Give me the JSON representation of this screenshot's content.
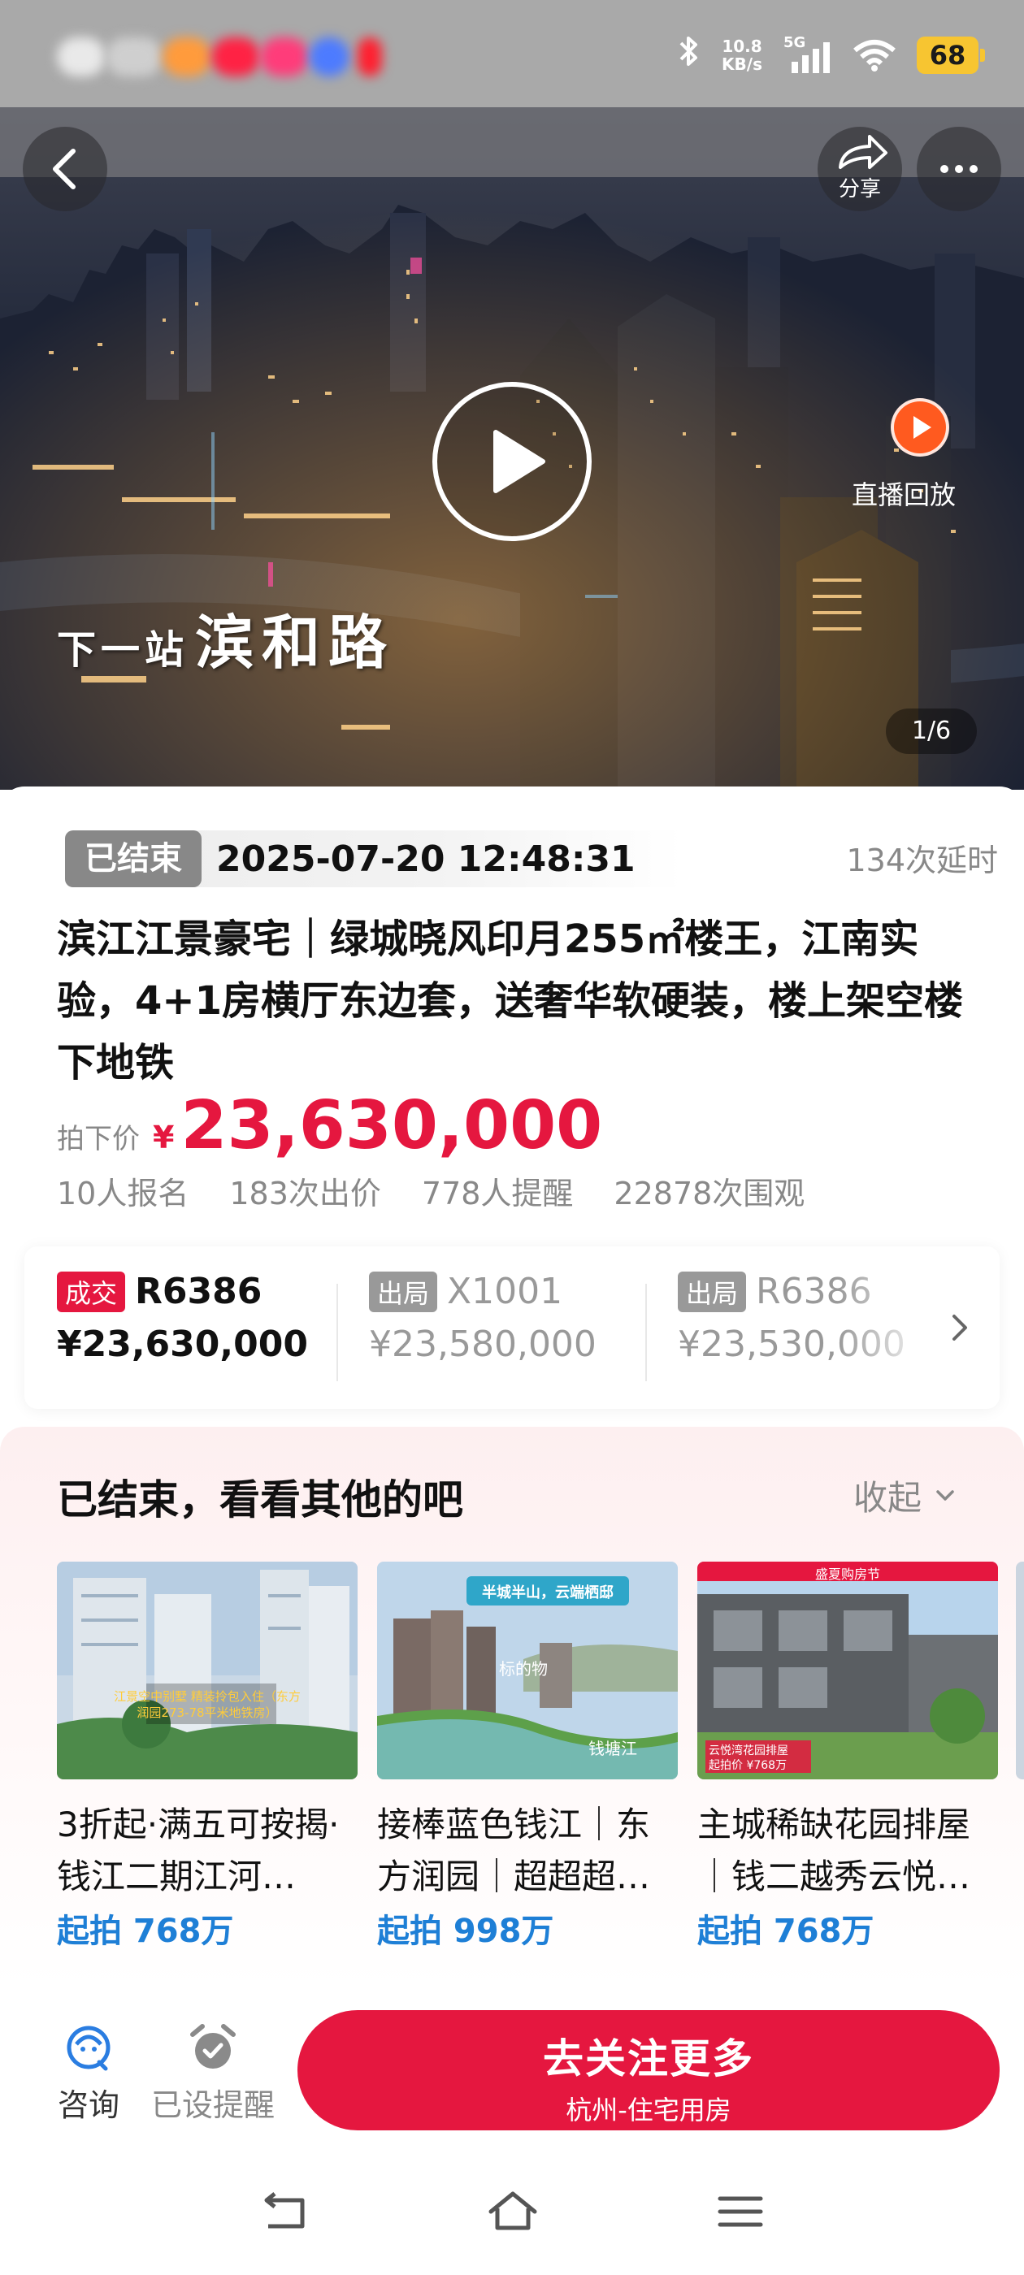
{
  "status_bar": {
    "network_speed_value": "10.8",
    "network_speed_unit": "KB/s",
    "signal_label": "5G",
    "battery": "68"
  },
  "hero": {
    "share_label": "分享",
    "live_replay_label": "直播回放",
    "caption_small": "下一站",
    "caption_big": "滨和路",
    "page_indicator": "1/6"
  },
  "auction": {
    "status_badge": "已结束",
    "end_time": "2025-07-20 12:48:31",
    "delay_count": "134次延时",
    "title": "滨江江景豪宅｜绿城晓风印月255㎡楼王，江南实验，4+1房横厅东边套，送奢华软硬装，楼上架空楼下地铁",
    "price_label": "拍下价",
    "currency": "¥",
    "price": "23,630,000",
    "stats": [
      "10人报名",
      "183次出价",
      "778人提醒",
      "22878次围观"
    ]
  },
  "bids": [
    {
      "tag": "成交",
      "code": "R6386",
      "amount": "¥23,630,000"
    },
    {
      "tag": "出局",
      "code": "X1001",
      "amount": "¥23,580,000"
    },
    {
      "tag": "出局",
      "code": "R6386",
      "amount": "¥23,530,000"
    }
  ],
  "recommendations": {
    "title": "已结束，看看其他的吧",
    "collapse_label": "收起",
    "items": [
      {
        "text": "3折起·满五可按揭·钱江二期江河…",
        "price": "起拍 768万",
        "image_text": "江景空中别墅 精装拎包入住（东方润园273-78平米地铁房）"
      },
      {
        "text": "接棒蓝色钱江｜东方润园｜超超超…",
        "price": "起拍 998万",
        "image_text": "半城半山，云端栖邸",
        "image_label_a": "标的物",
        "image_label_b": "钱塘江"
      },
      {
        "text": "主城稀缺花园排屋｜钱二越秀云悦…",
        "price": "起拍 768万",
        "image_text": "盛夏购房节",
        "image_label_a": "云悦湾花园排屋",
        "image_label_b": "起拍价 ¥768万"
      }
    ]
  },
  "action_bar": {
    "consult_label": "咨询",
    "reminder_label": "已设提醒",
    "follow_main": "去关注更多",
    "follow_sub": "杭州-住宅用房"
  },
  "colors": {
    "accent_red": "#e5173f",
    "price_blue": "#1e7fd6",
    "muted_gray": "#888888",
    "live_orange": "#ff5a1f",
    "battery_yellow": "#f7c531"
  },
  "icons": [
    "bluetooth-icon",
    "signal-icon",
    "wifi-icon",
    "back-icon",
    "share-icon",
    "more-icon",
    "play-icon",
    "live-replay-icon",
    "chevron-right-icon",
    "chevron-down-icon",
    "consult-icon",
    "alarm-icon",
    "nav-back-icon",
    "nav-home-icon",
    "nav-menu-icon"
  ]
}
